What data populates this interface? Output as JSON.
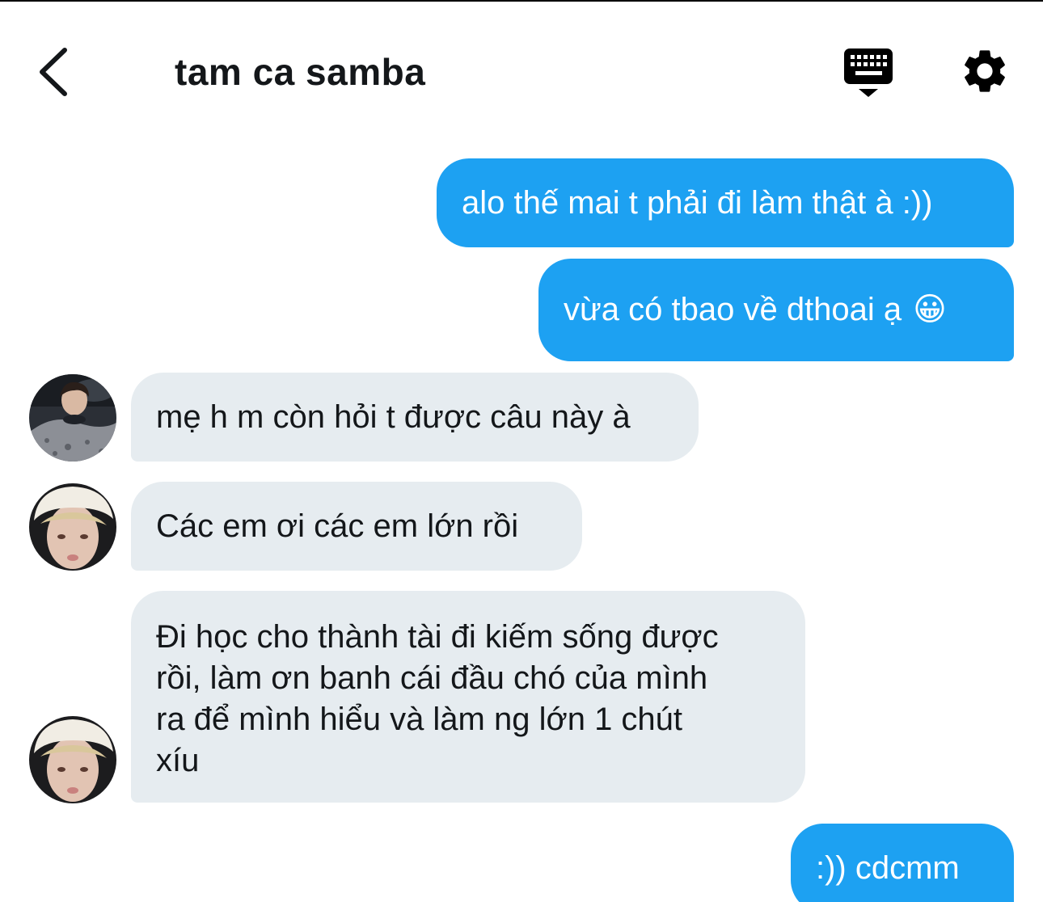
{
  "header": {
    "title": "tam ca samba"
  },
  "messages": [
    {
      "direction": "sent",
      "text": "alo thế mai t phải đi làm thật à :))"
    },
    {
      "direction": "sent",
      "text": "vừa có tbao về dthoai ạ",
      "emoji": "😀"
    },
    {
      "direction": "received",
      "text": "mẹ h m còn hỏi t được câu này à"
    },
    {
      "direction": "received",
      "text": "Các em ơi các em lớn rồi"
    },
    {
      "direction": "received",
      "text": "Đi học cho thành tài đi kiếm sống được\nrồi, làm ơn banh cái đầu chó của mình\nra để mình hiểu và làm ng lớn 1 chút\nxíu"
    },
    {
      "direction": "sent",
      "text": ":)) cdcmm"
    }
  ],
  "colors": {
    "sent_bubble": "#1da1f2",
    "received_bubble": "#e6ecf0",
    "text": "#14171a"
  },
  "icons": {
    "back": "chevron-left-icon",
    "keyboard": "keyboard-icon",
    "settings": "gear-icon"
  }
}
